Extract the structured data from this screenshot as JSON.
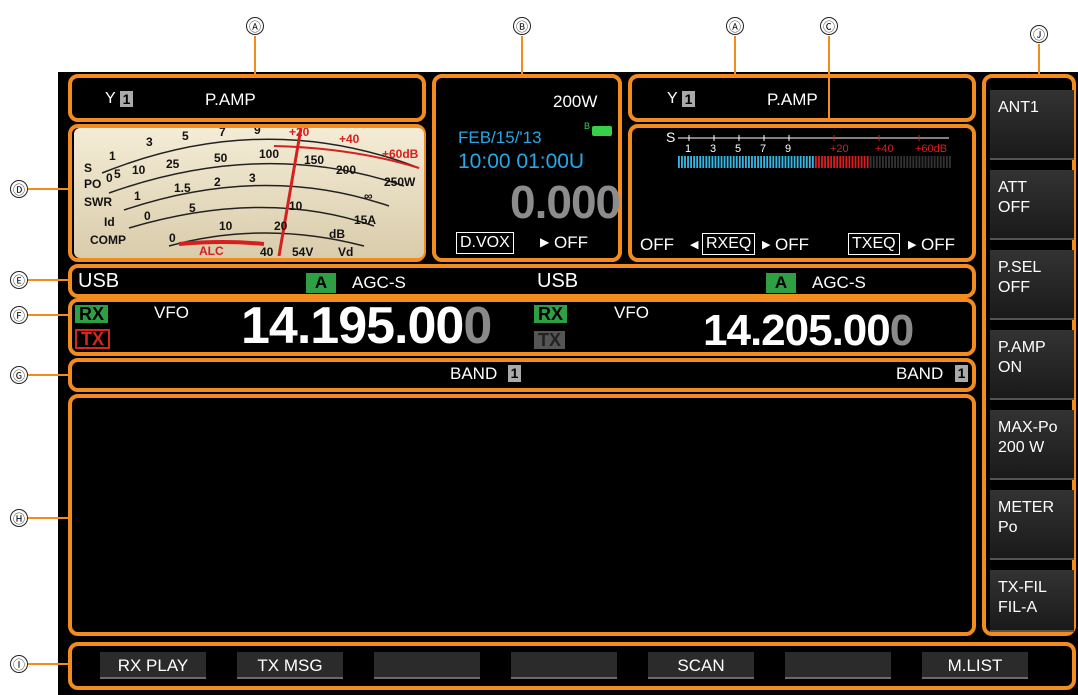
{
  "callouts": {
    "A": "Ⓐ",
    "B": "Ⓑ",
    "C": "Ⓒ",
    "D": "Ⓓ",
    "E": "Ⓔ",
    "F": "Ⓕ",
    "G": "Ⓖ",
    "H": "Ⓗ",
    "I": "Ⓘ",
    "J": "Ⓙ"
  },
  "left_status": {
    "antenna_num": "1",
    "preamp": "P.AMP"
  },
  "right_status": {
    "antenna_num": "1",
    "preamp": "P.AMP"
  },
  "center": {
    "power": "200W",
    "date": "FEB/15/'13",
    "battery_label": "B",
    "time": "10:00 01:00U",
    "value": "0.000",
    "dvox_label": "D.VOX",
    "dvox_state": "OFF"
  },
  "analog_meter": {
    "s_label": "S",
    "po_label": "PO",
    "swr_label": "SWR",
    "id_label": "Id",
    "comp_label": "COMP",
    "alc_label": "ALC",
    "s_ticks": [
      "1",
      "3",
      "5",
      "7",
      "9",
      "+20",
      "+40",
      "+60dB"
    ],
    "po_ticks": [
      "0",
      "5",
      "10",
      "25",
      "50",
      "100",
      "150",
      "200",
      "250W"
    ],
    "swr_ticks": [
      "1",
      "1.5",
      "2",
      "3",
      "∞"
    ],
    "id_ticks": [
      "0",
      "5",
      "10",
      "15A"
    ],
    "comp_ticks": [
      "0",
      "10",
      "20",
      "dB"
    ],
    "vd_ticks": [
      "40",
      "54V",
      "Vd"
    ]
  },
  "bar_meter": {
    "s_label": "S",
    "ticks": [
      "1",
      "3",
      "5",
      "7",
      "9",
      "+20",
      "+40",
      "+60dB"
    ],
    "level": 0.7,
    "peak_level": 0.3
  },
  "eq": {
    "rx_state_left": "OFF",
    "rxeq_label": "RXEQ",
    "rx_state_right": "OFF",
    "txeq_label": "TXEQ",
    "tx_state": "OFF"
  },
  "mode_row": {
    "left_mode": "USB",
    "left_agc_badge": "A",
    "left_agc": "AGC-S",
    "right_mode": "USB",
    "right_agc_badge": "A",
    "right_agc": "AGC-S"
  },
  "vfo_left": {
    "rx": "RX",
    "tx": "TX",
    "vfo_label": "VFO",
    "freq_main": "14.195.00",
    "freq_last": "0"
  },
  "vfo_right": {
    "rx": "RX",
    "tx": "TX",
    "vfo_label": "VFO",
    "freq_main": "14.205.00",
    "freq_last": "0"
  },
  "band_row": {
    "left_label": "BAND",
    "left_num": "1",
    "right_label": "BAND",
    "right_num": "1"
  },
  "function_keys": [
    "RX PLAY",
    "TX MSG",
    "",
    "",
    "SCAN",
    "",
    "M.LIST"
  ],
  "side_keys": [
    {
      "line1": "ANT1",
      "line2": ""
    },
    {
      "line1": "ATT",
      "line2": "OFF"
    },
    {
      "line1": "P.SEL",
      "line2": "OFF"
    },
    {
      "line1": "P.AMP",
      "line2": "ON"
    },
    {
      "line1": "MAX-Po",
      "line2": "200 W"
    },
    {
      "line1": "METER",
      "line2": "Po"
    },
    {
      "line1": "TX-FIL",
      "line2": "FIL-A"
    }
  ],
  "colors": {
    "highlight": "#f28c1e",
    "rx_badge": "#2ea043",
    "tx_badge": "#d12a1a",
    "date_blue": "#27a7e7",
    "meter_cyan": "#36b6e3",
    "meter_red": "#d62020"
  }
}
